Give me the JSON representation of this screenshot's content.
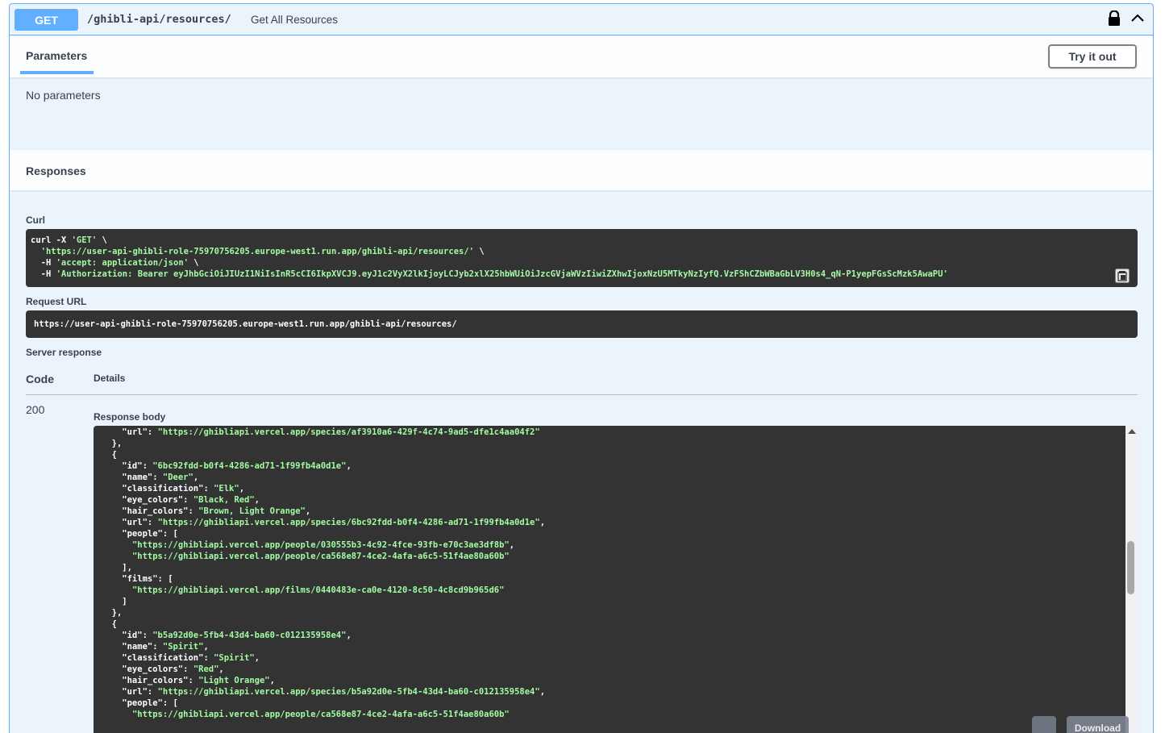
{
  "endpoint": {
    "method": "GET",
    "path": "/ghibli-api/resources/",
    "summary": "Get All Resources"
  },
  "parameters": {
    "tab_label": "Parameters",
    "try_label": "Try it out",
    "empty_text": "No parameters"
  },
  "responses": {
    "title": "Responses",
    "curl_label": "Curl",
    "curl_lines": [
      [
        {
          "t": "curl -X ",
          "c": "wht"
        },
        {
          "t": "'GET'",
          "c": "str"
        },
        {
          "t": " \\",
          "c": "wht"
        }
      ],
      [
        {
          "t": "  ",
          "c": "wht"
        },
        {
          "t": "'https://user-api-ghibli-role-75970756205.europe-west1.run.app/ghibli-api/resources/'",
          "c": "str"
        },
        {
          "t": " \\",
          "c": "wht"
        }
      ],
      [
        {
          "t": "  -H ",
          "c": "wht"
        },
        {
          "t": "'accept: application/json'",
          "c": "str"
        },
        {
          "t": " \\",
          "c": "wht"
        }
      ],
      [
        {
          "t": "  -H ",
          "c": "wht"
        },
        {
          "t": "'Authorization: Bearer eyJhbGciOiJIUzI1NiIsInR5cCI6IkpXVCJ9.eyJ1c2VyX2lkIjoyLCJyb2xlX25hbWUiOiJzcGVjaWVzIiwiZXhwIjoxNzU5MTkyNzIyfQ.VzFShCZbWBaGbLV3H0s4_qN-P1yepFGsScMzk5AwaPU'",
          "c": "str"
        }
      ]
    ],
    "request_url_label": "Request URL",
    "request_url": "https://user-api-ghibli-role-75970756205.europe-west1.run.app/ghibli-api/resources/",
    "server_response_label": "Server response",
    "col_code": "Code",
    "col_details": "Details",
    "status_code": "200",
    "response_body_label": "Response body",
    "download_label": "Download",
    "body_lines": [
      [
        {
          "t": "    ",
          "c": "key"
        },
        {
          "t": "\"url\"",
          "c": "key"
        },
        {
          "t": ": ",
          "c": "key"
        },
        {
          "t": "\"https://ghibliapi.vercel.app/species/af3910a6-429f-4c74-9ad5-dfe1c4aa04f2\"",
          "c": "str"
        }
      ],
      [
        {
          "t": "  },",
          "c": "key"
        }
      ],
      [
        {
          "t": "  {",
          "c": "key"
        }
      ],
      [
        {
          "t": "    \"id\"",
          "c": "key"
        },
        {
          "t": ": ",
          "c": "key"
        },
        {
          "t": "\"6bc92fdd-b0f4-4286-ad71-1f99fb4a0d1e\"",
          "c": "str"
        },
        {
          "t": ",",
          "c": "key"
        }
      ],
      [
        {
          "t": "    \"name\"",
          "c": "key"
        },
        {
          "t": ": ",
          "c": "key"
        },
        {
          "t": "\"Deer\"",
          "c": "str"
        },
        {
          "t": ",",
          "c": "key"
        }
      ],
      [
        {
          "t": "    \"classification\"",
          "c": "key"
        },
        {
          "t": ": ",
          "c": "key"
        },
        {
          "t": "\"Elk\"",
          "c": "str"
        },
        {
          "t": ",",
          "c": "key"
        }
      ],
      [
        {
          "t": "    \"eye_colors\"",
          "c": "key"
        },
        {
          "t": ": ",
          "c": "key"
        },
        {
          "t": "\"Black, Red\"",
          "c": "str"
        },
        {
          "t": ",",
          "c": "key"
        }
      ],
      [
        {
          "t": "    \"hair_colors\"",
          "c": "key"
        },
        {
          "t": ": ",
          "c": "key"
        },
        {
          "t": "\"Brown, Light Orange\"",
          "c": "str"
        },
        {
          "t": ",",
          "c": "key"
        }
      ],
      [
        {
          "t": "    \"url\"",
          "c": "key"
        },
        {
          "t": ": ",
          "c": "key"
        },
        {
          "t": "\"https://ghibliapi.vercel.app/species/6bc92fdd-b0f4-4286-ad71-1f99fb4a0d1e\"",
          "c": "str"
        },
        {
          "t": ",",
          "c": "key"
        }
      ],
      [
        {
          "t": "    \"people\"",
          "c": "key"
        },
        {
          "t": ": [",
          "c": "key"
        }
      ],
      [
        {
          "t": "      ",
          "c": "key"
        },
        {
          "t": "\"https://ghibliapi.vercel.app/people/030555b3-4c92-4fce-93fb-e70c3ae3df8b\"",
          "c": "str"
        },
        {
          "t": ",",
          "c": "key"
        }
      ],
      [
        {
          "t": "      ",
          "c": "key"
        },
        {
          "t": "\"https://ghibliapi.vercel.app/people/ca568e87-4ce2-4afa-a6c5-51f4ae80a60b\"",
          "c": "str"
        }
      ],
      [
        {
          "t": "    ],",
          "c": "key"
        }
      ],
      [
        {
          "t": "    \"films\"",
          "c": "key"
        },
        {
          "t": ": [",
          "c": "key"
        }
      ],
      [
        {
          "t": "      ",
          "c": "key"
        },
        {
          "t": "\"https://ghibliapi.vercel.app/films/0440483e-ca0e-4120-8c50-4c8cd9b965d6\"",
          "c": "str"
        }
      ],
      [
        {
          "t": "    ]",
          "c": "key"
        }
      ],
      [
        {
          "t": "  },",
          "c": "key"
        }
      ],
      [
        {
          "t": "  {",
          "c": "key"
        }
      ],
      [
        {
          "t": "    \"id\"",
          "c": "key"
        },
        {
          "t": ": ",
          "c": "key"
        },
        {
          "t": "\"b5a92d0e-5fb4-43d4-ba60-c012135958e4\"",
          "c": "str"
        },
        {
          "t": ",",
          "c": "key"
        }
      ],
      [
        {
          "t": "    \"name\"",
          "c": "key"
        },
        {
          "t": ": ",
          "c": "key"
        },
        {
          "t": "\"Spirit\"",
          "c": "str"
        },
        {
          "t": ",",
          "c": "key"
        }
      ],
      [
        {
          "t": "    \"classification\"",
          "c": "key"
        },
        {
          "t": ": ",
          "c": "key"
        },
        {
          "t": "\"Spirit\"",
          "c": "str"
        },
        {
          "t": ",",
          "c": "key"
        }
      ],
      [
        {
          "t": "    \"eye_colors\"",
          "c": "key"
        },
        {
          "t": ": ",
          "c": "key"
        },
        {
          "t": "\"Red\"",
          "c": "str"
        },
        {
          "t": ",",
          "c": "key"
        }
      ],
      [
        {
          "t": "    \"hair_colors\"",
          "c": "key"
        },
        {
          "t": ": ",
          "c": "key"
        },
        {
          "t": "\"Light Orange\"",
          "c": "str"
        },
        {
          "t": ",",
          "c": "key"
        }
      ],
      [
        {
          "t": "    \"url\"",
          "c": "key"
        },
        {
          "t": ": ",
          "c": "key"
        },
        {
          "t": "\"https://ghibliapi.vercel.app/species/b5a92d0e-5fb4-43d4-ba60-c012135958e4\"",
          "c": "str"
        },
        {
          "t": ",",
          "c": "key"
        }
      ],
      [
        {
          "t": "    \"people\"",
          "c": "key"
        },
        {
          "t": ": [",
          "c": "key"
        }
      ],
      [
        {
          "t": "      ",
          "c": "key"
        },
        {
          "t": "\"https://ghibliapi.vercel.app/people/ca568e87-4ce2-4afa-a6c5-51f4ae80a60b\"",
          "c": "str"
        }
      ]
    ]
  },
  "icons": {
    "lock": "lock-icon",
    "collapse": "chevron-up-icon",
    "copy": "clipboard-icon"
  },
  "colors": {
    "get_method": "#61affe",
    "code_bg": "#333333",
    "string": "#a2fca2"
  }
}
